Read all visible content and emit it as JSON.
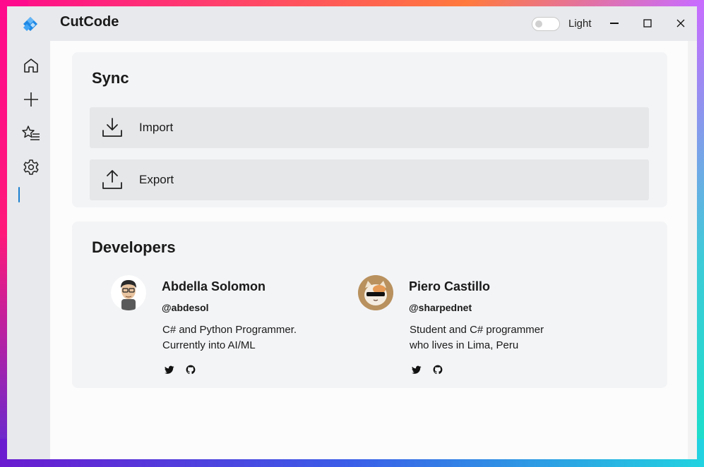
{
  "app": {
    "title": "CutCode"
  },
  "titlebar": {
    "theme_label": "Light"
  },
  "sidebar": {
    "items": [
      {
        "name": "home",
        "icon": "home-icon"
      },
      {
        "name": "add",
        "icon": "plus-icon"
      },
      {
        "name": "favorites",
        "icon": "star-list-icon"
      },
      {
        "name": "settings",
        "icon": "gear-icon",
        "active": true
      }
    ]
  },
  "sync": {
    "title": "Sync",
    "import_label": "Import",
    "export_label": "Export"
  },
  "developers": {
    "title": "Developers",
    "people": [
      {
        "name": "Abdella Solomon",
        "handle": "@abdesol",
        "bio_line1": "C# and Python Programmer.",
        "bio_line2": "Currently into AI/ML"
      },
      {
        "name": "Piero Castillo",
        "handle": "@sharpednet",
        "bio_line1": "Student and C# programmer",
        "bio_line2": "who lives in Lima, Peru"
      }
    ]
  },
  "colors": {
    "accent": "#1a7fd0",
    "card_bg": "#f3f4f6",
    "button_bg": "#e6e7e9"
  }
}
